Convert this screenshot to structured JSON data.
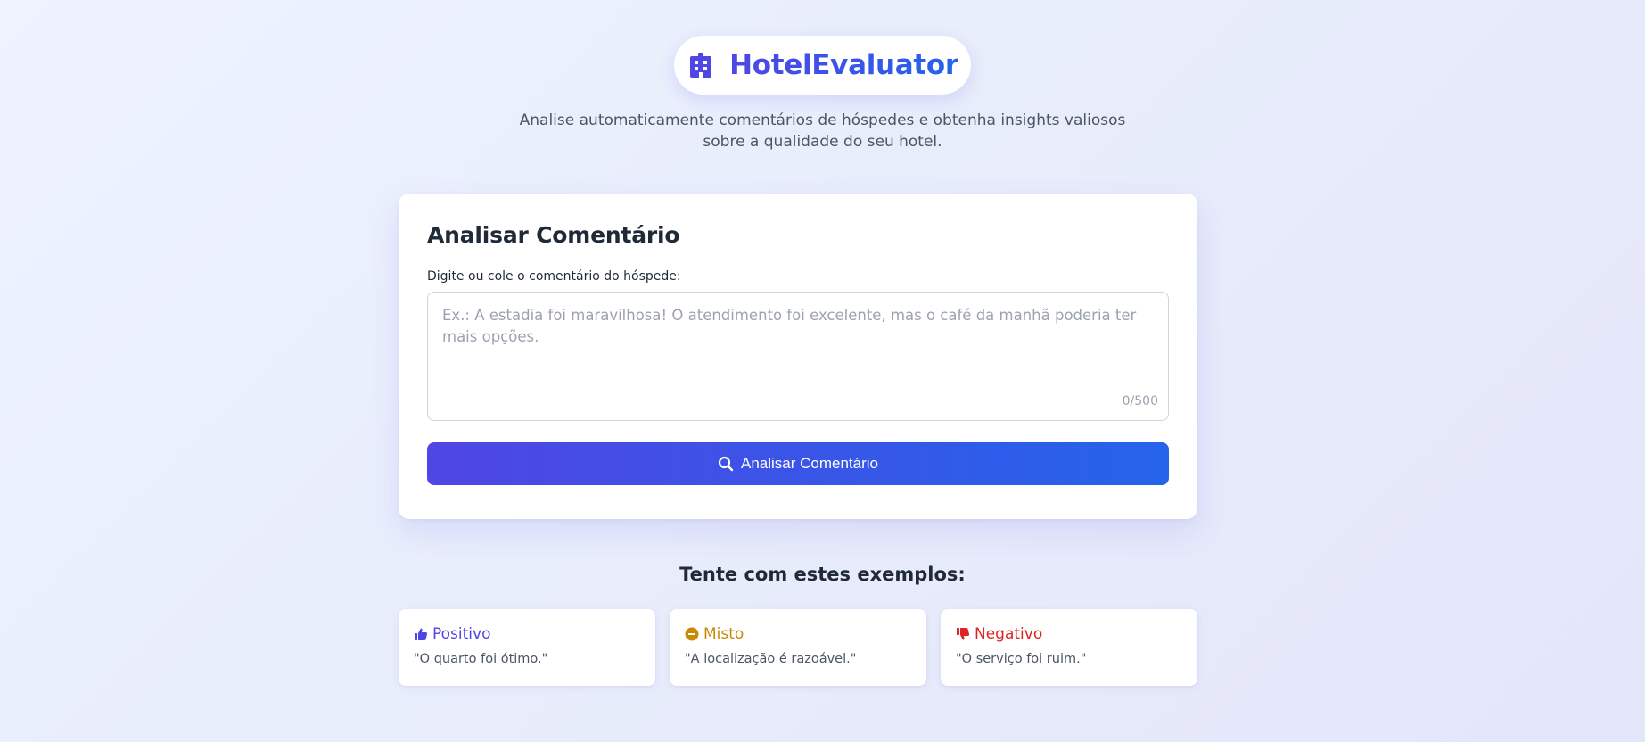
{
  "header": {
    "brand": "HotelEvaluator",
    "brand_icon": "hotel-building-icon",
    "subtitle_line1": "Analise automaticamente comentários de hóspedes e obtenha insights valiosos",
    "subtitle_line2": "sobre a qualidade do seu hotel."
  },
  "form": {
    "title": "Analisar Comentário",
    "label": "Digite ou cole o comentário do hóspede:",
    "placeholder": "Ex.: A estadia foi maravilhosa! O atendimento foi excelente, mas o café da manhã poderia ter mais opções.",
    "value": "",
    "char_count": "0/500",
    "button_label": "Analisar Comentário",
    "button_icon": "search-icon"
  },
  "examples": {
    "title": "Tente com estes exemplos:",
    "items": [
      {
        "label": "Positivo",
        "text": "\"O quarto foi ótimo.\"",
        "icon": "thumbs-up-icon",
        "color": "#4f46e5"
      },
      {
        "label": "Misto",
        "text": "\"A localização é razoável.\"",
        "icon": "minus-circle-icon",
        "color": "#ca8a04"
      },
      {
        "label": "Negativo",
        "text": "\"O serviço foi ruim.\"",
        "icon": "thumbs-down-icon",
        "color": "#dc2626"
      }
    ]
  },
  "colors": {
    "accent_start": "#4f46e5",
    "accent_end": "#2563eb"
  }
}
